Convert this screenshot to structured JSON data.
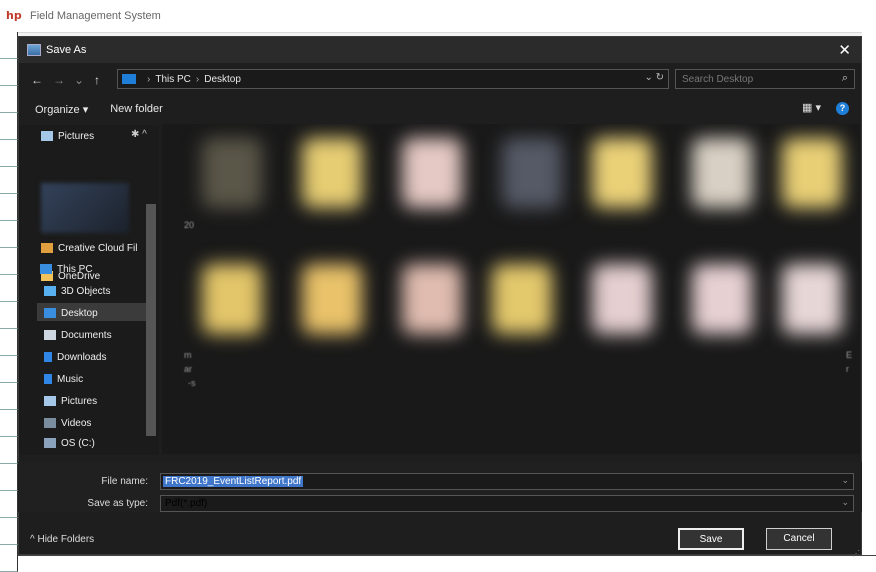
{
  "app": {
    "title": "Field Management System",
    "logo_text": "hp"
  },
  "dialog": {
    "title": "Save As",
    "close_glyph": "✕",
    "nav": {
      "back": "←",
      "forward": "→",
      "recent": "⌄",
      "up": "↑"
    },
    "breadcrumb": [
      "This PC",
      "Desktop"
    ],
    "breadcrumb_sep": "›",
    "address_controls": "⌄  ↻",
    "search_placeholder": "Search Desktop",
    "toolbar": {
      "organize": "Organize ▾",
      "new_folder": "New folder",
      "view": "▦ ▾",
      "help": "?"
    },
    "sidebar": {
      "items": [
        {
          "label": "Pictures",
          "icon": "pictures-icon"
        },
        {
          "label": "Creative Cloud Fil",
          "icon": "creative-cloud-icon"
        },
        {
          "label": "OneDrive",
          "icon": "onedrive-icon"
        },
        {
          "label": "This PC",
          "icon": "this-pc-icon"
        },
        {
          "label": "3D Objects",
          "icon": "3d-objects-icon"
        },
        {
          "label": "Desktop",
          "icon": "desktop-icon"
        },
        {
          "label": "Documents",
          "icon": "documents-icon"
        },
        {
          "label": "Downloads",
          "icon": "downloads-icon"
        },
        {
          "label": "Music",
          "icon": "music-icon"
        },
        {
          "label": "Pictures",
          "icon": "pictures-icon"
        },
        {
          "label": "Videos",
          "icon": "videos-icon"
        },
        {
          "label": "OS (C:)",
          "icon": "drive-icon"
        }
      ],
      "selected": "Desktop",
      "pin_glyph": "✱ ^"
    },
    "content": {
      "labels": [
        "20",
        "m",
        "ar",
        "-s",
        "E",
        "r"
      ]
    },
    "fields": {
      "file_name_label": "File name:",
      "file_name_value": "FRC2019_EventListReport.pdf",
      "save_as_type_label": "Save as type:",
      "save_as_type_value": "Pdf(*.pdf)",
      "dropdown_glyph": "⌄"
    },
    "footer": {
      "hide_folders": "^ Hide Folders",
      "save": "Save",
      "cancel": "Cancel"
    }
  }
}
